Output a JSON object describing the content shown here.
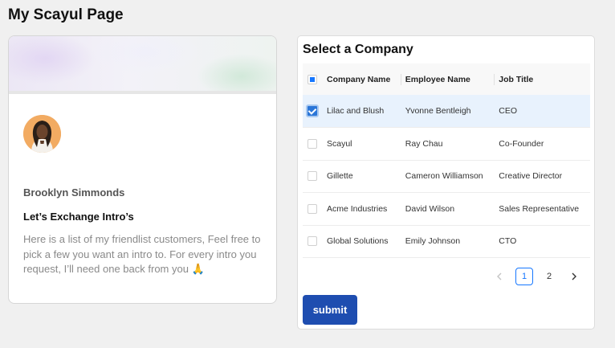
{
  "page": {
    "title": "My Scayul Page"
  },
  "profile": {
    "name": "Brooklyn Simmonds",
    "subtitle": "Let’s Exchange Intro’s",
    "description": "Here is a list of my friendlist customers, Feel free to pick a few you want an intro to. For every intro you request, I’ll need one back from you 🙏"
  },
  "companies": {
    "title": "Select a Company",
    "columns": [
      "Company Name",
      "Employee Name",
      "Job Title"
    ],
    "rows": [
      {
        "company": "Lilac and Blush",
        "employee": "Yvonne Bentleigh",
        "job": "CEO",
        "selected": true
      },
      {
        "company": "Scayul",
        "employee": "Ray Chau",
        "job": "Co-Founder",
        "selected": false
      },
      {
        "company": "Gillette",
        "employee": "Cameron Williamson",
        "job": "Creative Director",
        "selected": false
      },
      {
        "company": "Acme Industries",
        "employee": "David Wilson",
        "job": "Sales Representative",
        "selected": false
      },
      {
        "company": "Global Solutions",
        "employee": "Emily Johnson",
        "job": "CTO",
        "selected": false
      }
    ]
  },
  "pagination": {
    "prev_icon": "chevron-left-icon",
    "pages": [
      "1",
      "2"
    ],
    "current": "1",
    "next_icon": "chevron-right-icon"
  },
  "submit": {
    "label": "submit"
  },
  "colors": {
    "accent": "#1677ff",
    "submit_bg": "#1e4db0",
    "selected_row": "#e8f2fd"
  }
}
